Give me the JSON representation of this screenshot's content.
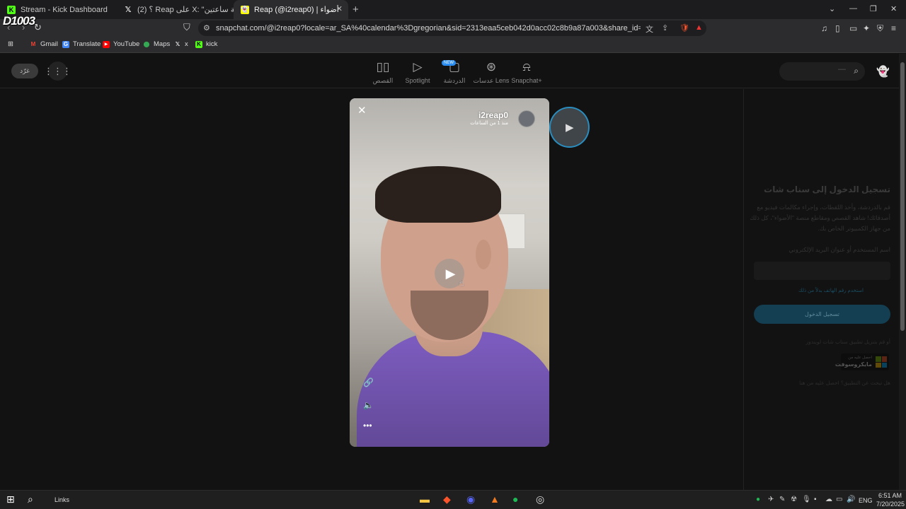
{
  "browser": {
    "tabs": [
      {
        "title": "Stream - Kick Dashboard",
        "icon": "kick-icon",
        "active": false
      },
      {
        "title": "(2) ؟ Reap على X: \"بث خمسة ساعتين\" /",
        "icon": "x-icon",
        "active": false
      },
      {
        "title": "Reap (@i2reap0) | عدسات \"وعدسات \"أضواء",
        "icon": "snapchat-icon",
        "active": true
      }
    ],
    "new_tab": "+",
    "address": "snapchat.com/@i2reap0?locale=ar_SA%40calendar%3Dgregorian&sid=2313eaa5ceb042d0acc02c8b9a87a003&share_id=0EsdQMi4TBapO6-fZ...",
    "bookmarks": [
      {
        "label": "Gmail",
        "icon": "gmail-icon"
      },
      {
        "label": "Translate",
        "icon": "translate-icon"
      },
      {
        "label": "YouTube",
        "icon": "youtube-icon"
      },
      {
        "label": "Maps",
        "icon": "maps-icon"
      },
      {
        "label": "x",
        "icon": "x-icon"
      },
      {
        "label": "kick",
        "icon": "kick-icon"
      }
    ],
    "notification_count": "1"
  },
  "overlay": {
    "watermark": "D1003"
  },
  "snapchat": {
    "signin_pill": "غرّد",
    "nav": [
      {
        "label": "القصص",
        "icon": "stories-icon"
      },
      {
        "label": "Spotlight",
        "icon": "spotlight-icon"
      },
      {
        "label": "الدردشة",
        "icon": "chat-icon",
        "badge": "NEW"
      },
      {
        "label": "عدسات Lens",
        "icon": "lens-icon"
      },
      {
        "label": "Snapchat+",
        "icon": "snapchat-plus-icon"
      }
    ],
    "story": {
      "username": "i2reap0",
      "timestamp": "منذ 1 من الساعات"
    },
    "login": {
      "title": "تسجيل الدخول إلى سناب شات",
      "description": "قم بالدردشة، وأخذ اللقطات، وإجراء مكالمات فيديو مع أصدقائك! شاهد القصص ومقاطع منصة \"الأضواء\"، كل ذلك من جهاز الكمبيوتر الخاص بك.",
      "username_label": "اسم المستخدم أو عنوان البريد الإلكتروني",
      "phone_link": "استخدم رقم الهاتف بدلاً من ذلك",
      "login_button": "تسجيل الدخول",
      "get_app": "أو قم بتنزيل تطبيق سناب شات لويندوز",
      "ms_small": "احصل عليه من",
      "ms_store": "مايكروسوفت",
      "help": "هل تبحث عن التطبيق؟ احصل عليه من هنا"
    }
  },
  "taskbar": {
    "links": "Links",
    "lang": "ENG",
    "time": "6:51 AM",
    "date": "7/20/2025"
  }
}
